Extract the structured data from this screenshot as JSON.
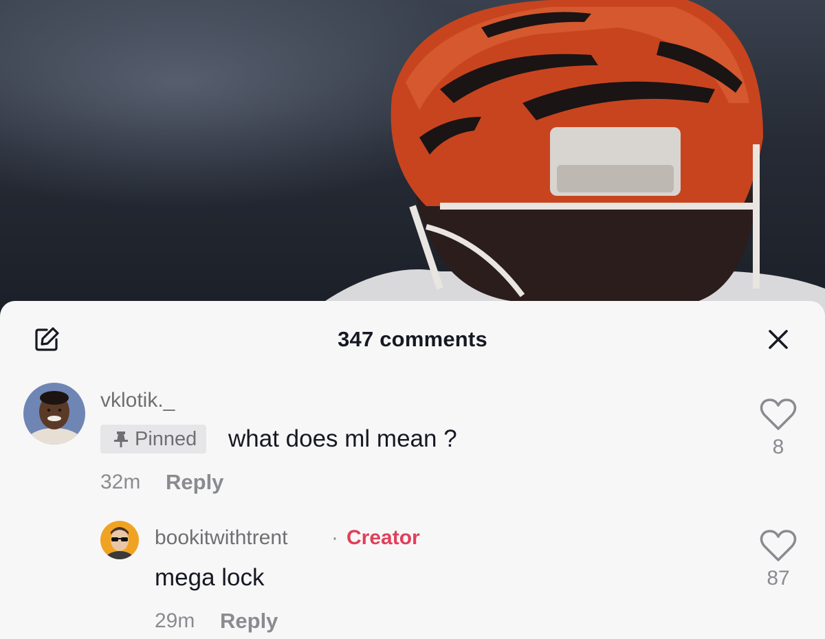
{
  "header": {
    "title": "347 comments",
    "edit_icon": "edit-icon",
    "close_icon": "close-icon"
  },
  "comments": [
    {
      "username": "vklotik._",
      "pinned_label": "Pinned",
      "text": "what does ml mean ?",
      "time": "32m",
      "reply_label": "Reply",
      "likes": "8"
    }
  ],
  "replies": [
    {
      "username": "bookitwithtrent",
      "separator": "·",
      "badge": "Creator",
      "text": "mega lock",
      "time": "29m",
      "reply_label": "Reply",
      "likes": "87"
    }
  ],
  "colors": {
    "creator": "#e0405a",
    "sheet_bg": "#f7f7f7",
    "muted_text": "#8a8b91",
    "primary_text": "#161823"
  }
}
